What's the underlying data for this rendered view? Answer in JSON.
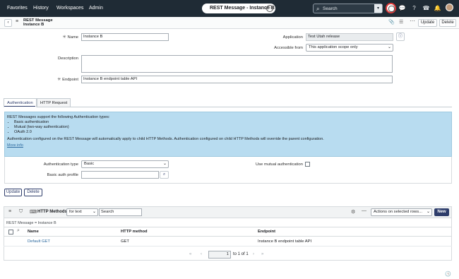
{
  "topnav": {
    "favorites": "Favorites",
    "history": "History",
    "workspaces": "Workspaces",
    "admin": "Admin",
    "record_pill": "REST Message - Instance B",
    "search_placeholder": "Search"
  },
  "header": {
    "title_line1": "REST Message",
    "title_line2": "Instance B",
    "update": "Update",
    "delete": "Delete"
  },
  "form": {
    "name_label": "Name",
    "name_value": "Instance B",
    "application_label": "Application",
    "application_value": "Test Utah release",
    "accessible_label": "Accessible from",
    "accessible_value": "This application scope only",
    "description_label": "Description",
    "description_value": "",
    "endpoint_label": "Endpoint",
    "endpoint_value": "Instance B endpoint table API"
  },
  "tabs": [
    "Authentication",
    "HTTP Request"
  ],
  "auth_info": {
    "intro": "REST Messages support the following Authentication types:",
    "types": [
      "Basic authentication",
      "Mutual (two-way authentication)",
      "OAuth 2.0"
    ],
    "note": "Authentication configured on the REST Message will automatically apply to child HTTP Methods. Authentication configured on child HTTP Methods will override the parent configuration.",
    "more": "More info"
  },
  "auth": {
    "type_label": "Authentication type",
    "type_value": "Basic",
    "profile_label": "Basic auth profile",
    "profile_value": "",
    "mutual_label": "Use mutual authentication"
  },
  "actions": {
    "update": "Update",
    "delete": "Delete"
  },
  "related_list": {
    "title": "HTTP Methods",
    "filter_field": "for text",
    "search_placeholder": "Search",
    "actions_select": "Actions on selected rows...",
    "new_button": "New",
    "breadcrumb": "REST Message = Instance B",
    "columns": [
      "Name",
      "HTTP method",
      "Endpoint"
    ],
    "rows": [
      {
        "name": "Default GET",
        "method": "GET",
        "endpoint": "Instance B endpoint table API"
      }
    ],
    "pager_current": "1",
    "pager_text": "to 1 of 1"
  }
}
